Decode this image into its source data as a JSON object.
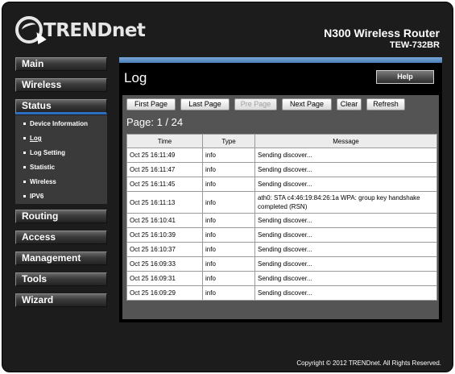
{
  "header": {
    "logo_text": "TRENDnet",
    "product_title": "N300 Wireless Router",
    "model": "TEW-732BR"
  },
  "sidebar": {
    "items": [
      {
        "label": "Main"
      },
      {
        "label": "Wireless"
      },
      {
        "label": "Status"
      },
      {
        "label": "Routing"
      },
      {
        "label": "Access"
      },
      {
        "label": "Management"
      },
      {
        "label": "Tools"
      },
      {
        "label": "Wizard"
      }
    ],
    "status_subitems": [
      {
        "label": "Device Information"
      },
      {
        "label": "Log"
      },
      {
        "label": "Log Setting"
      },
      {
        "label": "Statistic"
      },
      {
        "label": "Wireless"
      },
      {
        "label": "IPV6"
      }
    ]
  },
  "main": {
    "title": "Log",
    "help_label": "Help",
    "toolbar": {
      "first_page": "First Page",
      "last_page": "Last Page",
      "pre_page": "Pre Page",
      "next_page": "Next Page",
      "clear": "Clear",
      "refresh": "Refresh"
    },
    "page_indicator": "Page: 1 / 24",
    "table": {
      "headers": [
        "Time",
        "Type",
        "Message"
      ],
      "rows": [
        {
          "time": "Oct 25 16:11:49",
          "type": "info",
          "message": "Sending discover..."
        },
        {
          "time": "Oct 25 16:11:47",
          "type": "info",
          "message": "Sending discover..."
        },
        {
          "time": "Oct 25 16:11:45",
          "type": "info",
          "message": "Sending discover..."
        },
        {
          "time": "Oct 25 16:11:13",
          "type": "info",
          "message": "ath0: STA c4:46:19:84:26:1a WPA: group key handshake completed (RSN)"
        },
        {
          "time": "Oct 25 16:10:41",
          "type": "info",
          "message": "Sending discover..."
        },
        {
          "time": "Oct 25 16:10:39",
          "type": "info",
          "message": "Sending discover..."
        },
        {
          "time": "Oct 25 16:10:37",
          "type": "info",
          "message": "Sending discover..."
        },
        {
          "time": "Oct 25 16:09:33",
          "type": "info",
          "message": "Sending discover..."
        },
        {
          "time": "Oct 25 16:09:31",
          "type": "info",
          "message": "Sending discover..."
        },
        {
          "time": "Oct 25 16:09:29",
          "type": "info",
          "message": "Sending discover..."
        }
      ]
    }
  },
  "footer": {
    "copyright": "Copyright © 2012 TRENDnet. All Rights Reserved."
  },
  "colors": {
    "background": "#1c1c1c",
    "active_accent": "#2b6fc2",
    "panel_bar": "#4a7fb8"
  }
}
